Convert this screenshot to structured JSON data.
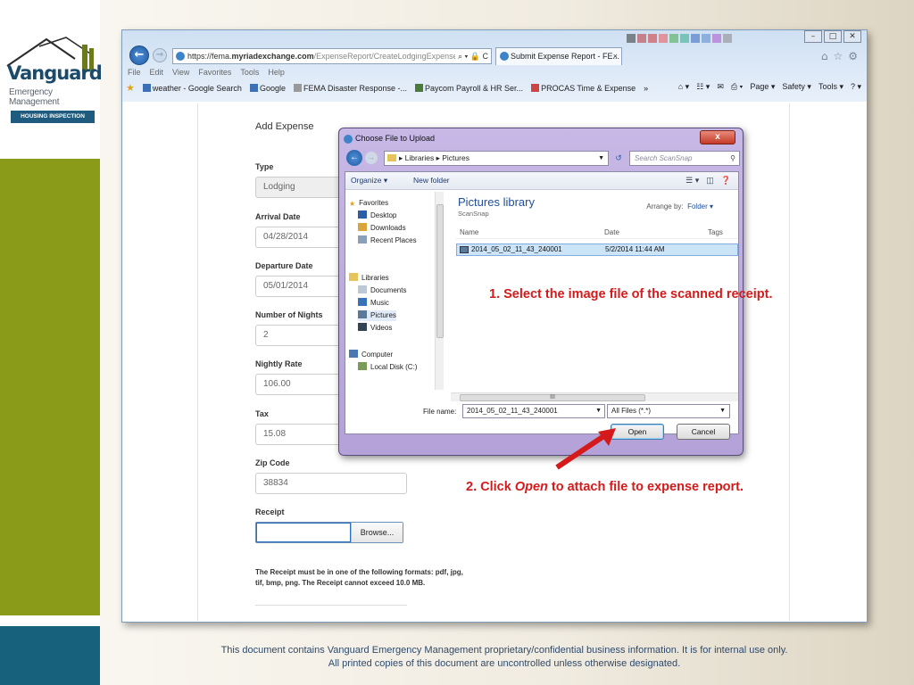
{
  "logo": {
    "word": "Vanguard",
    "sub": "Emergency Management",
    "tag": "HOUSING INSPECTION SERVICES"
  },
  "browser": {
    "url_prefix": "https://fema.",
    "url_host": "myriadexchange.com",
    "url_path": "/ExpenseReport/CreateLodgingExpense",
    "url_controls": "⌕ ▾ 🔒 C",
    "tab_title": "Submit Expense Report - FE...",
    "tab_close": "×",
    "menu": [
      "File",
      "Edit",
      "View",
      "Favorites",
      "Tools",
      "Help"
    ],
    "favorites": [
      "weather - Google Search",
      "Google",
      "FEMA Disaster Response -...",
      "Paycom Payroll & HR Ser...",
      "PROCAS Time & Expense"
    ],
    "fav_more": "»",
    "toolbar_right": [
      "⌂ ▾",
      "☷ ▾",
      "✉",
      "⎙ ▾",
      "Page ▾",
      "Safety ▾",
      "Tools ▾",
      "? ▾"
    ],
    "accent": "#3d83c7"
  },
  "form": {
    "heading": "Add Expense",
    "fields": [
      {
        "label": "Type",
        "value": "Lodging"
      },
      {
        "label": "Arrival Date",
        "value": "04/28/2014"
      },
      {
        "label": "Departure Date",
        "value": "05/01/2014"
      },
      {
        "label": "Number of Nights",
        "value": "2"
      },
      {
        "label": "Nightly Rate",
        "value": "106.00"
      },
      {
        "label": "Tax",
        "value": "15.08"
      },
      {
        "label": "Zip Code",
        "value": "38834"
      }
    ],
    "receipt_label": "Receipt",
    "browse_label": "Browse...",
    "note": "The Receipt must be in one of the following formats: pdf, jpg, tif, bmp, png. The Receipt cannot exceed 10.0 MB."
  },
  "dialog": {
    "title": "Choose File to Upload",
    "path": [
      "Libraries",
      "Pictures"
    ],
    "search_placeholder": "Search ScanSnap",
    "organize": "Organize ▾",
    "new_folder": "New folder",
    "tree": {
      "favorites": "Favorites",
      "fav_items": [
        "Desktop",
        "Downloads",
        "Recent Places"
      ],
      "libraries": "Libraries",
      "lib_items": [
        "Documents",
        "Music",
        "Pictures",
        "Videos"
      ],
      "computer": "Computer",
      "comp_items": [
        "Local Disk (C:)"
      ]
    },
    "library_title": "Pictures library",
    "library_sub": "ScanSnap",
    "arrange_label": "Arrange by:",
    "arrange_value": "Folder ▾",
    "columns": [
      "Name",
      "Date",
      "Tags"
    ],
    "file": {
      "name": "2014_05_02_11_43_240001",
      "date": "5/2/2014 11:44 AM"
    },
    "scroll_h": "III",
    "file_name_label": "File name:",
    "file_name_value": "2014_05_02_11_43_240001",
    "file_type": "All Files (*.*)",
    "open": "Open",
    "cancel": "Cancel",
    "close": "x"
  },
  "annotations": {
    "step1": "1.  Select the image file of the scanned receipt.",
    "step2_pre": "2.  Click ",
    "step2_em": "Open",
    "step2_post": " to attach file to expense report."
  },
  "footer": {
    "line1": "This document contains Vanguard Emergency Management proprietary/confidential business information. It is for internal use only.",
    "line2": "All printed copies of this document are uncontrolled unless otherwise designated."
  },
  "colors": {
    "green_bar": "#8a9b1a",
    "blue_bar": "#17617c",
    "annotation": "#d41a1a"
  }
}
